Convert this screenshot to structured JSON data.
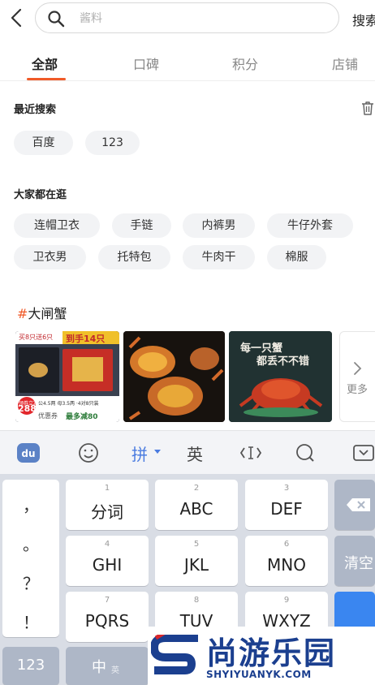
{
  "search": {
    "placeholder": "酱料",
    "button": "搜索"
  },
  "tabs": [
    "全部",
    "口碑",
    "积分",
    "店铺"
  ],
  "recent": {
    "title": "最近搜索",
    "items": [
      "百度",
      "123"
    ]
  },
  "popular": {
    "title": "大家都在逛",
    "items": [
      "连帽卫衣",
      "手链",
      "内裤男",
      "牛仔外套",
      "卫衣男",
      "托特包",
      "牛肉干",
      "棉服"
    ]
  },
  "topic": {
    "hash": "#",
    "name": "大闸蟹"
  },
  "thumbs": [
    {
      "promo_left": "买8只送6只",
      "promo_right": "到手14只",
      "coupon_hint": "领券立减",
      "price": "288",
      "detail": "公4.5两 母3.5两 ·4对8只装",
      "coupon_text": "优惠券",
      "coupon_value": "最多减80"
    },
    {},
    {
      "title_line1": "每一只蟹",
      "title_line2": "都丢不不错"
    }
  ],
  "more_label": "更多",
  "keyboard": {
    "toolbar": {
      "pinyin": "拼",
      "english": "英"
    },
    "punct": [
      "，",
      "。",
      "？",
      "！"
    ],
    "keys": [
      {
        "num": "1",
        "label": "分词"
      },
      {
        "num": "2",
        "label": "ABC"
      },
      {
        "num": "3",
        "label": "DEF"
      },
      {
        "num": "4",
        "label": "GHI"
      },
      {
        "num": "5",
        "label": "JKL"
      },
      {
        "num": "6",
        "label": "MNO"
      },
      {
        "num": "7",
        "label": "PQRS"
      },
      {
        "num": "8",
        "label": "TUV"
      },
      {
        "num": "9",
        "label": "WXYZ"
      }
    ],
    "clear": "清空",
    "num_switch": "123",
    "lang_main": "中",
    "lang_sub": "英"
  },
  "watermark": {
    "cn": "尚游乐园",
    "en": "SHYIYUANYK.COM"
  }
}
